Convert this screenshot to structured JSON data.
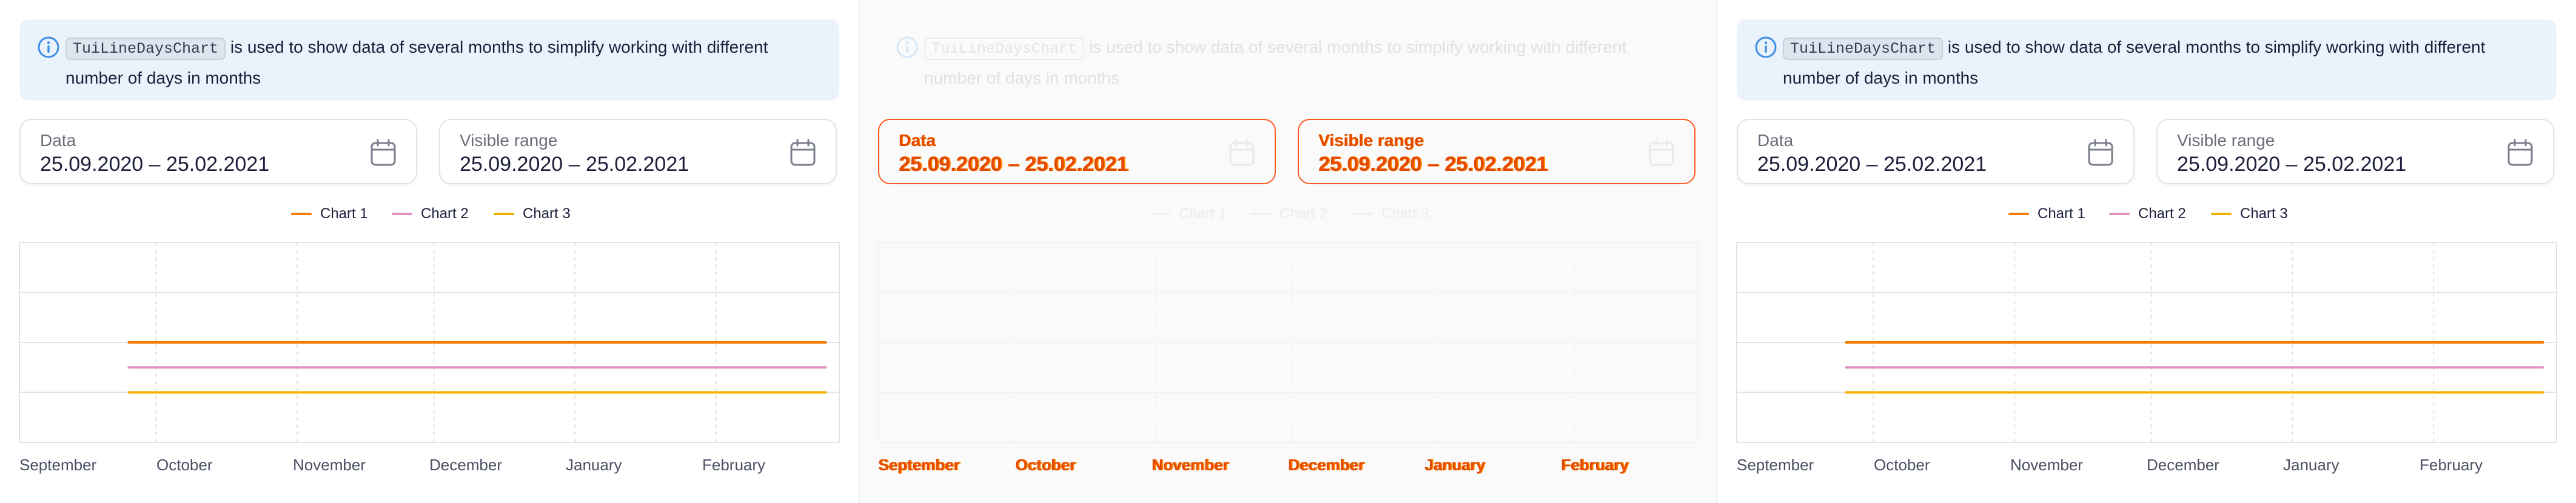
{
  "colors": {
    "chart1": "#f57c00",
    "chart2": "#e48fc6",
    "chart3": "#f2b100",
    "info_accent": "#3d8ee3",
    "error_outline": "#ff5a1f"
  },
  "notice": {
    "icon": "info-icon",
    "code": "TuiLineDaysChart",
    "text": "is used to show data of several months to simplify working with different number of days in months"
  },
  "fields": {
    "data": {
      "label": "Data",
      "value": "25.09.2020 – 25.02.2021",
      "icon": "calendar-icon"
    },
    "range": {
      "label": "Visible range",
      "value": "25.09.2020 – 25.02.2021",
      "icon": "calendar-icon"
    }
  },
  "legend": [
    "Chart 1",
    "Chart 2",
    "Chart 3"
  ],
  "months": [
    "September",
    "October",
    "November",
    "December",
    "January",
    "February"
  ],
  "chart_data": {
    "type": "line",
    "x_range": [
      "2020-09-01",
      "2021-02-28"
    ],
    "visible_range": [
      "2020-09-25",
      "2021-02-25"
    ],
    "x_tick_labels": [
      "September",
      "October",
      "November",
      "December",
      "January",
      "February"
    ],
    "ylim": [
      0,
      4
    ],
    "grid": true,
    "legend_position": "top",
    "series": [
      {
        "name": "Chart 1",
        "color": "#f57c00",
        "points": [
          [
            "2020-09-25",
            2
          ],
          [
            "2021-02-25",
            2
          ]
        ]
      },
      {
        "name": "Chart 2",
        "color": "#e48fc6",
        "points": [
          [
            "2020-09-25",
            1.5
          ],
          [
            "2021-02-25",
            1.5
          ]
        ]
      },
      {
        "name": "Chart 3",
        "color": "#f2b100",
        "points": [
          [
            "2020-09-25",
            1
          ],
          [
            "2021-02-25",
            1
          ]
        ]
      }
    ]
  }
}
